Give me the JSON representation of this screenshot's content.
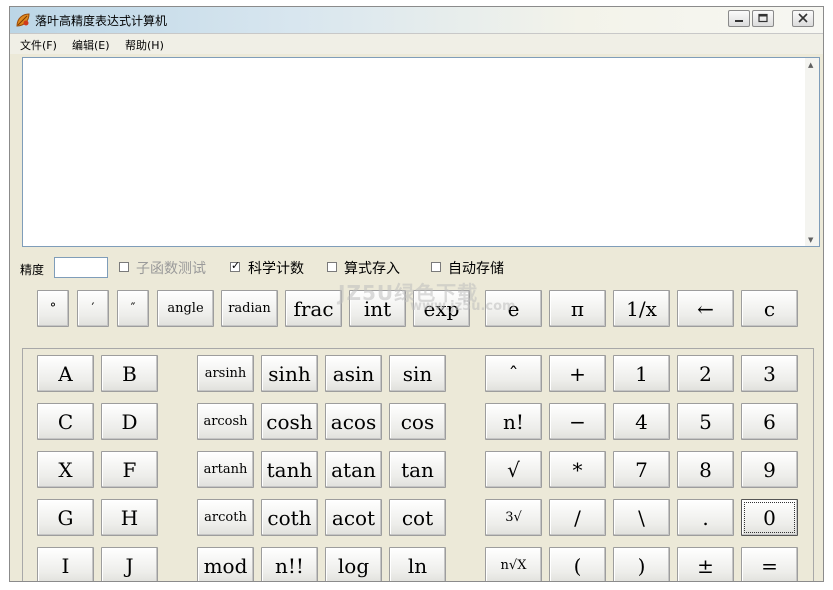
{
  "window": {
    "title": "落叶高精度表达式计算机"
  },
  "menu": {
    "file": "文件(F)",
    "edit": "编辑(E)",
    "help": "帮助(H)"
  },
  "expression": {
    "value": ""
  },
  "options": {
    "precision_label": "精度",
    "precision_value": "",
    "subfunc_test": {
      "label": "子函数测试",
      "checked": false,
      "enabled": false
    },
    "sci_notation": {
      "label": "科学计数",
      "checked": true
    },
    "store_expr": {
      "label": "算式存入",
      "checked": false
    },
    "auto_save": {
      "label": "自动存储",
      "checked": false
    }
  },
  "watermark": {
    "line1": "JZ5U绿色下载",
    "line2": "www.jz5u.com"
  },
  "row_top": [
    "°",
    "′",
    "″",
    "angle",
    "radian",
    "frac",
    "int",
    "exp",
    "e",
    "π",
    "1/x",
    "←",
    "c"
  ],
  "vars": [
    [
      "A",
      "B"
    ],
    [
      "C",
      "D"
    ],
    [
      "X",
      "F"
    ],
    [
      "G",
      "H"
    ],
    [
      "I",
      "J"
    ]
  ],
  "funcs": [
    [
      "arsinh",
      "sinh",
      "asin",
      "sin"
    ],
    [
      "arcosh",
      "cosh",
      "acos",
      "cos"
    ],
    [
      "artanh",
      "tanh",
      "atan",
      "tan"
    ],
    [
      "arcoth",
      "coth",
      "acot",
      "cot"
    ],
    [
      "mod",
      "n!!",
      "log",
      "ln"
    ]
  ],
  "ops": [
    [
      "ˆ",
      "+",
      "1",
      "2",
      "3"
    ],
    [
      "n!",
      "−",
      "4",
      "5",
      "6"
    ],
    [
      "√",
      "*",
      "7",
      "8",
      "9"
    ],
    [
      "3√",
      "/",
      "\\",
      ".",
      "0"
    ],
    [
      "n√X",
      "(",
      ")",
      "±",
      "="
    ]
  ]
}
